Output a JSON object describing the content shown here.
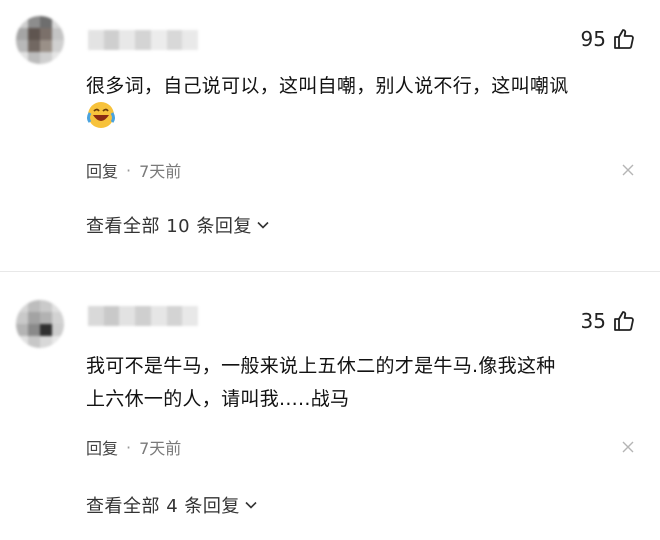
{
  "comments": [
    {
      "likes": "95",
      "text_line1": "很多词，自己说可以，这叫自嘲，别人说不行，这叫嘲讽",
      "text_line2": "",
      "has_emoji": true,
      "emoji_icon": "laughing-crying-emoji-icon",
      "reply_label": "回复",
      "separator": "·",
      "time": "7天前",
      "more_replies": "查看全部 10 条回复"
    },
    {
      "likes": "35",
      "text_line1": "我可不是牛马，一般来说上五休二的才是牛马.像我这种",
      "text_line2": "上六休一的人，请叫我.....战马",
      "has_emoji": false,
      "reply_label": "回复",
      "separator": "·",
      "time": "7天前",
      "more_replies": "查看全部 4 条回复"
    }
  ],
  "colors": {
    "meta_gray": "#7a7a7a",
    "emoji_yellow": "#f7c23b"
  }
}
